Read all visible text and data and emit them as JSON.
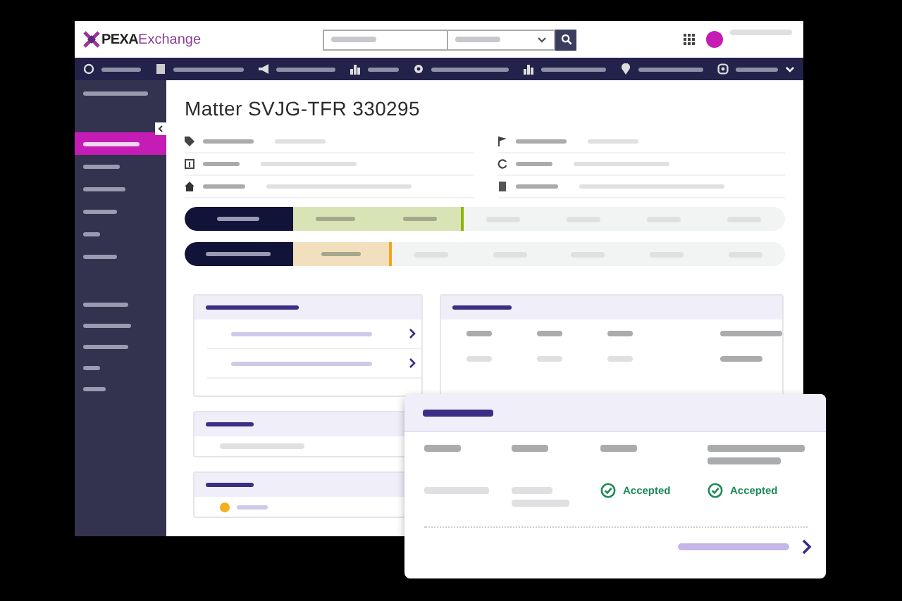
{
  "brand": {
    "mark": "PEXA",
    "name": "Exchange"
  },
  "sidebar": {
    "items": [
      {
        "selected": true
      },
      {
        "selected": false
      },
      {
        "selected": false
      },
      {
        "selected": false
      },
      {
        "selected": false
      },
      {
        "selected": false
      }
    ]
  },
  "matter": {
    "title": "Matter SVJG-TFR 330295"
  },
  "trackers": [
    {
      "level": 0.46,
      "color": "#8db600"
    },
    {
      "level": 0.34,
      "color": "#f2a51a"
    }
  ],
  "popup": {
    "statuses": [
      {
        "label": "Accepted"
      },
      {
        "label": "Accepted"
      }
    ]
  }
}
